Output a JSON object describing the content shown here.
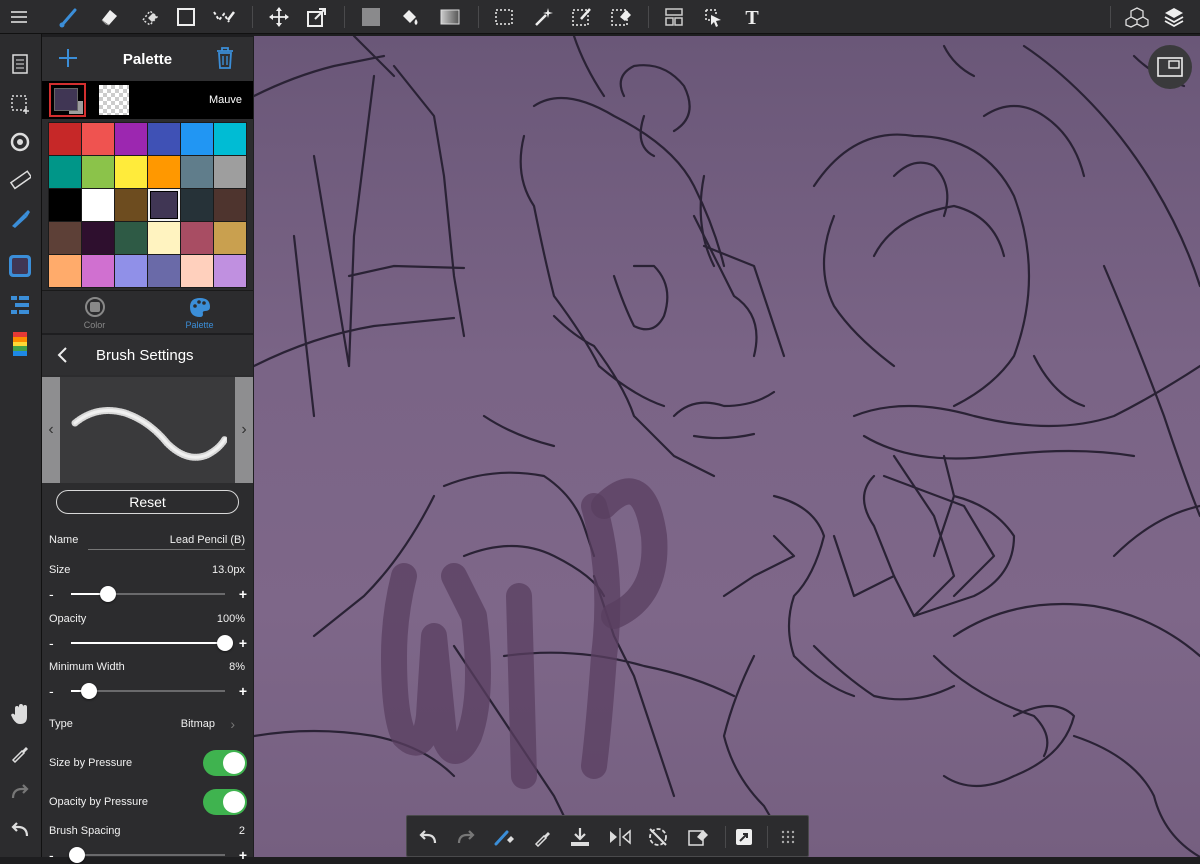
{
  "palette": {
    "title": "Palette",
    "current_color_name": "Mauve",
    "swatches": [
      "#c62828",
      "#ef5350",
      "#9c27b0",
      "#3f51b5",
      "#2196f3",
      "#00bcd4",
      "#009688",
      "#8bc34a",
      "#ffeb3b",
      "#ff9800",
      "#607d8b",
      "#9e9e9e",
      "#000000",
      "#ffffff",
      "#6d4c1f",
      "#403654",
      "#263238",
      "#4e342e",
      "#5d4037",
      "#2e0f2e",
      "#2e5a45",
      "#fff3c0",
      "#a84d63",
      "#c9a04f",
      "#ffab6b",
      "#d070d0",
      "#9090e8",
      "#6a6aa8",
      "#ffd0bd",
      "#c090e0"
    ],
    "selected_swatch": 15,
    "tabs": [
      {
        "label": "Color"
      },
      {
        "label": "Palette"
      }
    ],
    "accent": "#3b8ed8"
  },
  "brush": {
    "title": "Brush Settings",
    "reset_label": "Reset",
    "name_label": "Name",
    "name_value": "Lead Pencil (B)",
    "size_label": "Size",
    "size_value": "13.0px",
    "size_fraction": 0.24,
    "opacity_label": "Opacity",
    "opacity_value": "100%",
    "opacity_fraction": 1.0,
    "minwidth_label": "Minimum Width",
    "minwidth_value": "8%",
    "minwidth_fraction": 0.12,
    "type_label": "Type",
    "type_value": "Bitmap",
    "size_pressure_label": "Size by Pressure",
    "size_pressure_on": true,
    "opacity_pressure_label": "Opacity by Pressure",
    "opacity_pressure_on": true,
    "spacing_label": "Brush Spacing",
    "spacing_value": "2",
    "spacing_fraction": 0.04
  },
  "canvas": {
    "watermark": "WIP",
    "background": "#7a6486",
    "line_color": "#2a2235"
  },
  "toggle_color": "#3fb34f"
}
